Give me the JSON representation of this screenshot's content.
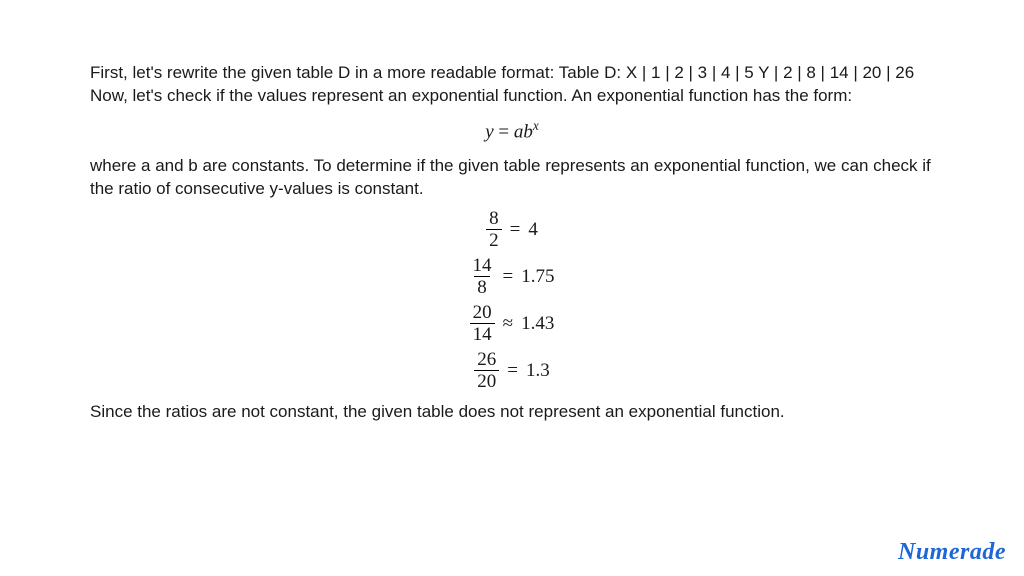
{
  "paragraphs": {
    "p1": "First, let's rewrite the given table D in a more readable format: Table D: X | 1 | 2 | 3 | 4 | 5 Y | 2 | 8 | 14 | 20 | 26 Now, let's check if the values represent an exponential function. An exponential function has the form:",
    "p2": "where a and b are constants. To determine if the given table represents an exponential function, we can check if the ratio of consecutive y-values is constant.",
    "p3": "Since the ratios are not constant, the given table does not represent an exponential function."
  },
  "equation": {
    "lhs_var": "y",
    "eq": " = ",
    "a": "a",
    "b": "b",
    "exp": "x"
  },
  "ratios": [
    {
      "num": "8",
      "den": "2",
      "op": "=",
      "val": "4"
    },
    {
      "num": "14",
      "den": "8",
      "op": "=",
      "val": "1.75"
    },
    {
      "num": "20",
      "den": "14",
      "op": "≈",
      "val": "1.43"
    },
    {
      "num": "26",
      "den": "20",
      "op": "=",
      "val": "1.3"
    }
  ],
  "brand": "Numerade",
  "chart_data": {
    "type": "table",
    "title": "Table D",
    "columns": [
      "X",
      "Y"
    ],
    "rows": [
      [
        1,
        2
      ],
      [
        2,
        8
      ],
      [
        3,
        14
      ],
      [
        4,
        20
      ],
      [
        5,
        26
      ]
    ],
    "derived_ratios": [
      4,
      1.75,
      1.43,
      1.3
    ],
    "exponential_form": "y = a * b^x",
    "conclusion": "not exponential (ratios not constant)"
  }
}
